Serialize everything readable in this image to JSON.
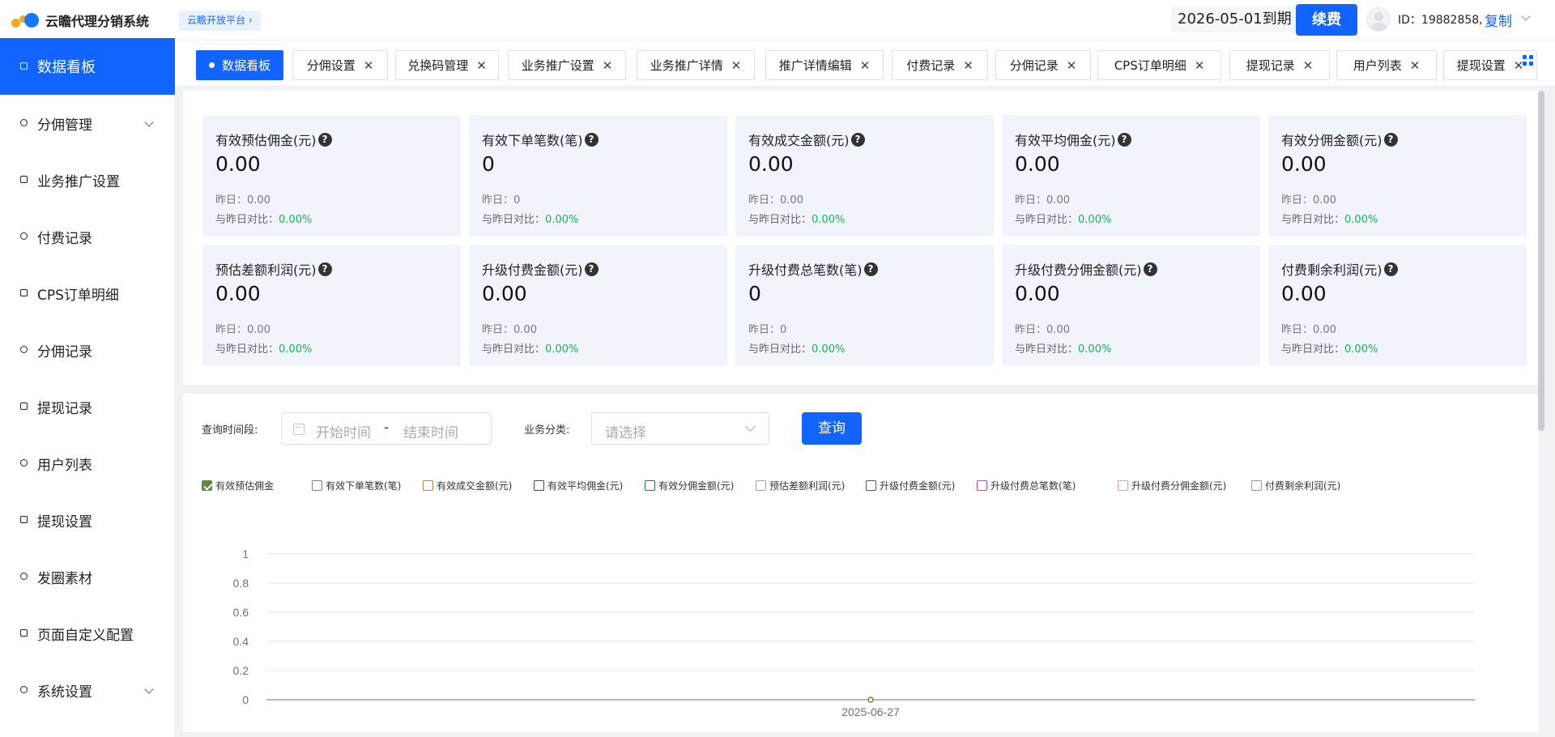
{
  "header": {
    "app_title": "云瞻代理分销系统",
    "platform_label": "云瞻开放平台",
    "expire_text": "2026-05-01到期",
    "renew_label": "续费",
    "user_id_text": "ID：19882858,",
    "copy_label": "复制"
  },
  "sidebar": {
    "items": [
      {
        "label": "数据看板",
        "active": true,
        "icon": "monitor-icon"
      },
      {
        "label": "分佣管理",
        "expandable": true,
        "icon": "user-icon"
      },
      {
        "label": "业务推广设置",
        "icon": "box-icon"
      },
      {
        "label": "付费记录",
        "icon": "card-icon"
      },
      {
        "label": "CPS订单明细",
        "icon": "refresh-icon"
      },
      {
        "label": "分佣记录",
        "icon": "target-icon"
      },
      {
        "label": "提现记录",
        "icon": "file-icon"
      },
      {
        "label": "用户列表",
        "icon": "person-icon"
      },
      {
        "label": "提现设置",
        "icon": "gear-icon"
      },
      {
        "label": "发圈素材",
        "icon": "image-icon"
      },
      {
        "label": "页面自定义配置",
        "icon": "palette-icon"
      },
      {
        "label": "系统设置",
        "expandable": true,
        "icon": "settings-icon"
      }
    ]
  },
  "tabs": [
    {
      "label": "数据看板",
      "active": true
    },
    {
      "label": "分佣设置"
    },
    {
      "label": "兑换码管理"
    },
    {
      "label": "业务推广设置"
    },
    {
      "label": "业务推广详情"
    },
    {
      "label": "推广详情编辑"
    },
    {
      "label": "付费记录"
    },
    {
      "label": "分佣记录"
    },
    {
      "label": "CPS订单明细"
    },
    {
      "label": "提现记录"
    },
    {
      "label": "用户列表"
    },
    {
      "label": "提现设置"
    }
  ],
  "stats": {
    "yesterday_prefix": "昨日：",
    "compare_prefix": "与昨日对比：",
    "cards": [
      {
        "title": "有效预估佣金(元)",
        "value": "0.00",
        "yesterday": "0.00",
        "compare": "0.00%"
      },
      {
        "title": "有效下单笔数(笔)",
        "value": "0",
        "yesterday": "0",
        "compare": "0.00%"
      },
      {
        "title": "有效成交金额(元)",
        "value": "0.00",
        "yesterday": "0.00",
        "compare": "0.00%"
      },
      {
        "title": "有效平均佣金(元)",
        "value": "0.00",
        "yesterday": "0.00",
        "compare": "0.00%"
      },
      {
        "title": "有效分佣金额(元)",
        "value": "0.00",
        "yesterday": "0.00",
        "compare": "0.00%"
      },
      {
        "title": "预估差额利润(元)",
        "value": "0.00",
        "yesterday": "0.00",
        "compare": "0.00%"
      },
      {
        "title": "升级付费金额(元)",
        "value": "0.00",
        "yesterday": "0.00",
        "compare": "0.00%"
      },
      {
        "title": "升级付费总笔数(笔)",
        "value": "0",
        "yesterday": "0",
        "compare": "0.00%"
      },
      {
        "title": "升级付费分佣金额(元)",
        "value": "0.00",
        "yesterday": "0.00",
        "compare": "0.00%"
      },
      {
        "title": "付费剩余利润(元)",
        "value": "0.00",
        "yesterday": "0.00",
        "compare": "0.00%"
      }
    ]
  },
  "query": {
    "period_label": "查询时间段:",
    "start_placeholder": "开始时间",
    "separator": "-",
    "end_placeholder": "结束时间",
    "category_label": "业务分类:",
    "category_placeholder": "请选择",
    "query_label": "查询"
  },
  "legend": [
    {
      "label": "有效预估佣金",
      "color": "#5b8c3e",
      "checked": true
    },
    {
      "label": "有效下单笔数(笔)",
      "color": "#2aa876",
      "checked": false
    },
    {
      "label": "有效成交金额(元)",
      "color": "#c08a2c",
      "checked": false
    },
    {
      "label": "有效平均佣金(元)",
      "color": "#7a2b4f",
      "checked": false
    },
    {
      "label": "有效分佣金额(元)",
      "color": "#1f6f7a",
      "checked": false
    },
    {
      "label": "预估差额利润(元)",
      "color": "#4fd38a",
      "checked": false
    },
    {
      "label": "升级付费金额(元)",
      "color": "#3b4fd3",
      "checked": false
    },
    {
      "label": "升级付费总笔数(笔)",
      "color": "#c640c6",
      "checked": false
    },
    {
      "label": "升级付费分佣金额(元)",
      "color": "#e8a0a0",
      "checked": false
    },
    {
      "label": "付费剩余利润(元)",
      "color": "#40b8e8",
      "checked": false
    }
  ],
  "chart_data": {
    "type": "line",
    "x": [
      "2025-06-27"
    ],
    "series": [
      {
        "name": "有效预估佣金",
        "values": [
          0
        ],
        "color": "#5b8c3e"
      }
    ],
    "ylim": [
      0,
      1
    ],
    "yticks": [
      "1",
      "0.8",
      "0.6",
      "0.4",
      "0.2",
      "0"
    ],
    "grid": true
  }
}
